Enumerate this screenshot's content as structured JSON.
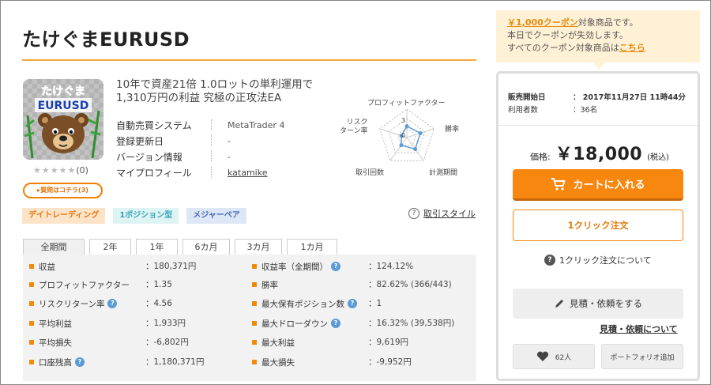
{
  "product": {
    "title": "たけぐまEURUSD",
    "thumb_text_top": "たけぐま",
    "thumb_text_bottom": "EURUSD",
    "stars": "★★★★★",
    "review_count": "(0)",
    "qa_button": "▸質問はコチラ(3)",
    "catch_line1": "10年で資産21倍 1.0ロットの単利運用で",
    "catch_line2": "1,310万円の利益 究極の正攻法EA"
  },
  "info": [
    {
      "label": "自動売買システム",
      "value": "MetaTrader 4"
    },
    {
      "label": "登録更新日",
      "value": "-"
    },
    {
      "label": "バージョン情報",
      "value": "-"
    },
    {
      "label": "マイプロフィール",
      "value": "katamike"
    }
  ],
  "radar": {
    "labels": {
      "profit_factor": "プロフィットファクター",
      "win_rate": "勝率",
      "period": "計測期間",
      "trades": "取引回数",
      "risk_return": "リスク\nターン率"
    },
    "ticks": [
      "0",
      "3"
    ],
    "values": [
      1.2,
      1.5,
      1.5,
      1.0,
      0.6
    ],
    "max": 3
  },
  "tags": [
    "デイトレーディング",
    "1ポジション型",
    "メジャーペア"
  ],
  "style_link": "取引スタイル",
  "tabs": [
    "全期間",
    "2年",
    "1年",
    "6カ月",
    "3カ月",
    "1カ月"
  ],
  "active_tab": 0,
  "stats_left": [
    {
      "label": "収益",
      "value": "：180,371円",
      "help": false
    },
    {
      "label": "プロフィットファクター",
      "value": "：1.35",
      "help": false
    },
    {
      "label": "リスクリターン率",
      "value": "：4.56",
      "help": true
    },
    {
      "label": "平均利益",
      "value": "：1,933円",
      "help": false
    },
    {
      "label": "平均損失",
      "value": "：-6,802円",
      "help": false
    },
    {
      "label": "口座残高",
      "value": "：1,180,371円",
      "help": true
    }
  ],
  "stats_right": [
    {
      "label": "収益率（全期間）",
      "value": "：124.12%",
      "help": true
    },
    {
      "label": "勝率",
      "value": "：82.62% (366/443)",
      "help": false
    },
    {
      "label": "最大保有ポジション数",
      "value": "：1",
      "help": true
    },
    {
      "label": "最大ドローダウン",
      "value": "：16.32% (39,538円)",
      "help": true
    },
    {
      "label": "最大利益",
      "value": "：9,619円",
      "help": false
    },
    {
      "label": "最大損失",
      "value": "：-9,952円",
      "help": false
    }
  ],
  "coupon": {
    "highlight": "￥1,000クーポン",
    "line1_rest": "対象商品です。",
    "line2": "本日でクーポンが失効します。",
    "line3_pre": "すべてのクーポン対象商品は",
    "line3_link": "こちら"
  },
  "buy": {
    "start_label": "販売開始日",
    "start_value": "：  2017年11月27日 11時44分",
    "users_label": "利用者数",
    "users_value": "：36名",
    "price_label": "価格:",
    "price": "￥18,000",
    "tax": "(税込)",
    "cart": "カートに入れる",
    "one_click": "1クリック注文",
    "one_click_about": "1クリック注文について",
    "estimate": "見積・依頼をする",
    "estimate_link": "見積・依頼について",
    "fav_count": "62人",
    "portfolio": "ポートフォリオ追加"
  },
  "colors": {
    "accent": "#f7870f",
    "rule": "#f5a63c",
    "radar": "#5a9bd5"
  }
}
